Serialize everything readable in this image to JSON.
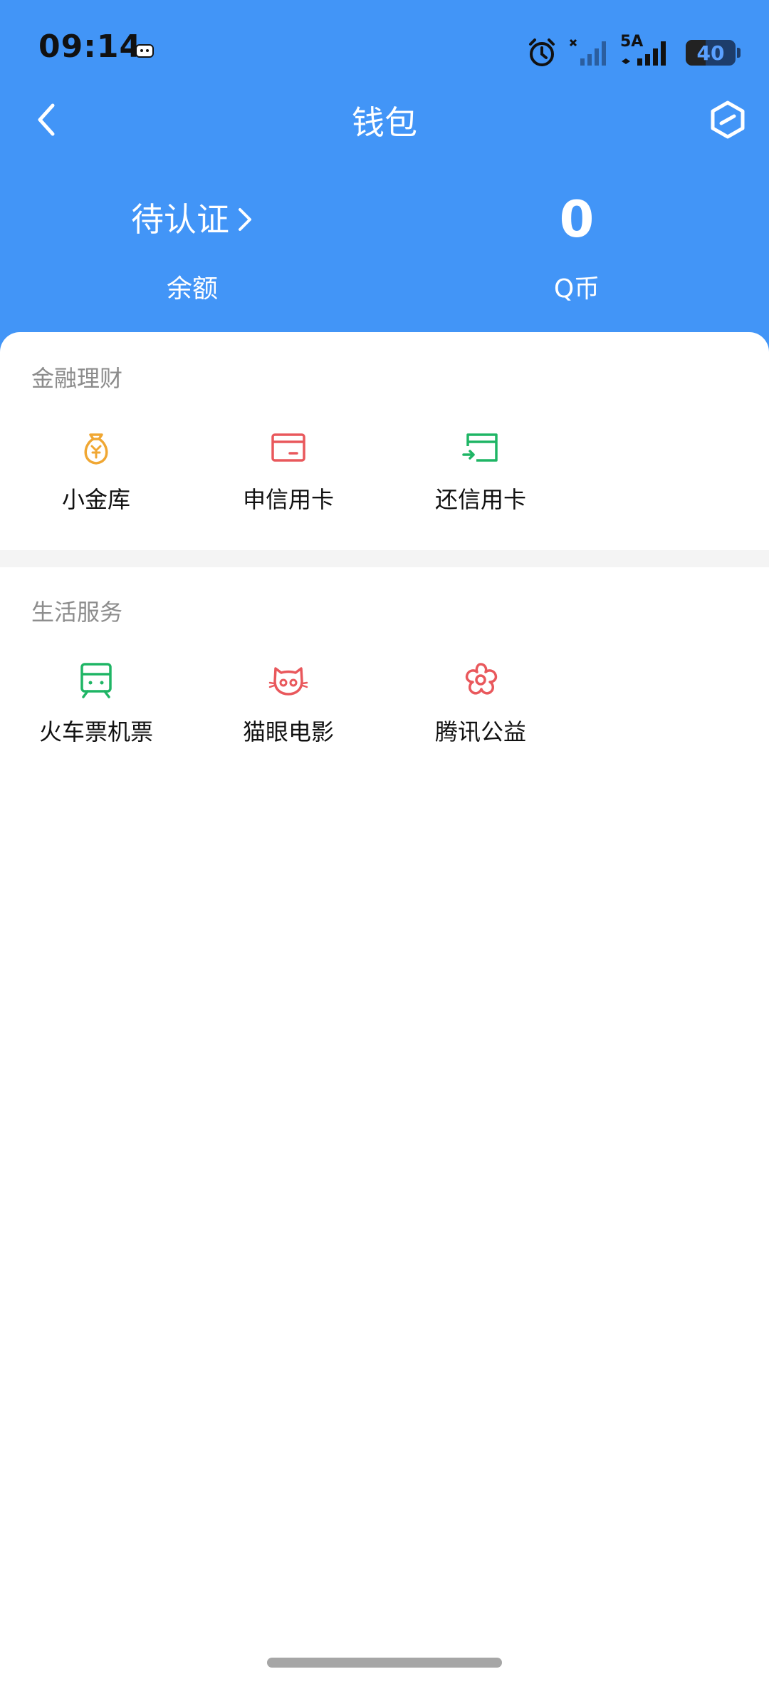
{
  "status_bar": {
    "time": "09:14",
    "network_label": "5A",
    "battery": "40"
  },
  "nav": {
    "title": "钱包"
  },
  "balance": {
    "left_value": "待认证",
    "left_caption": "余额",
    "right_value": "0",
    "right_caption": "Q币"
  },
  "sections": [
    {
      "title": "金融理财",
      "items": [
        {
          "label": "小金库",
          "icon": "money-bag-icon",
          "color": "#f0a733"
        },
        {
          "label": "申信用卡",
          "icon": "credit-card-icon",
          "color": "#e9585c"
        },
        {
          "label": "还信用卡",
          "icon": "card-repay-icon",
          "color": "#1fb565"
        }
      ]
    },
    {
      "title": "生活服务",
      "items": [
        {
          "label": "火车票机票",
          "icon": "train-icon",
          "color": "#1fb565"
        },
        {
          "label": "猫眼电影",
          "icon": "cat-icon",
          "color": "#e9585c"
        },
        {
          "label": "腾讯公益",
          "icon": "flower-icon",
          "color": "#e9585c"
        }
      ]
    }
  ],
  "colors": {
    "header_blue": "#4295f7",
    "section_gray": "#8c8c8c",
    "divider": "#f4f4f4"
  }
}
